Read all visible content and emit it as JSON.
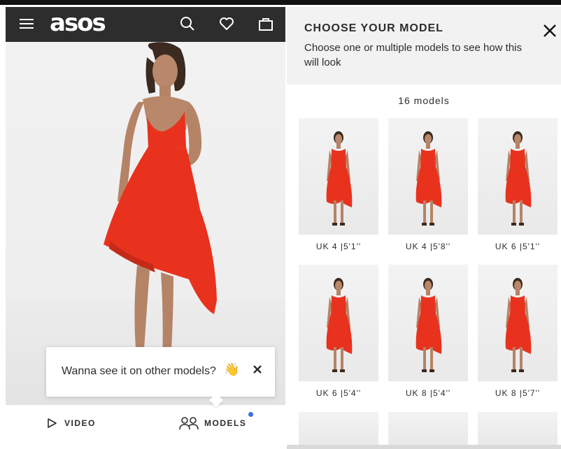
{
  "header": {
    "logo": "asos",
    "icons": [
      "menu-icon",
      "search-icon",
      "heart-icon",
      "bag-icon"
    ]
  },
  "tooltip": {
    "text": "Wanna see it on other models?",
    "emoji": "👋"
  },
  "bottom_bar": {
    "video_label": "VIDEO",
    "models_label": "MODELS"
  },
  "panel": {
    "title": "CHOOSE YOUR MODEL",
    "subtitle": "Choose one or multiple models to see how this will look",
    "count": "16 models",
    "models": [
      {
        "label": "UK 4 |5'1''"
      },
      {
        "label": "UK 4 |5'8''"
      },
      {
        "label": "UK 6 |5'1''"
      },
      {
        "label": "UK 6 |5'4''"
      },
      {
        "label": "UK 8 |5'4''"
      },
      {
        "label": "UK 8 |5'7''"
      }
    ]
  },
  "colors": {
    "header_bg": "#2d2d2d",
    "dress_red": "#e8321e",
    "accent_dot": "#3a6fe0"
  }
}
